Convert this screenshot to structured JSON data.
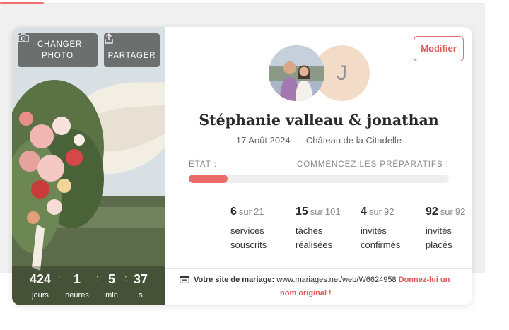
{
  "photo_panel": {
    "change_photo_label_line1": "CHANGER",
    "change_photo_label_line2": "PHOTO",
    "share_label": "PARTAGER",
    "countdown": [
      {
        "value": "424",
        "unit": "jours"
      },
      {
        "value": "1",
        "unit": "heures"
      },
      {
        "value": "5",
        "unit": "min"
      },
      {
        "value": "37",
        "unit": "s"
      }
    ],
    "separator": ":"
  },
  "info_panel": {
    "edit_label": "Modifier",
    "partner_initial": "J",
    "couple_name": "Stéphanie valleau & jonathan",
    "date": "17 Août 2024",
    "venue": "Château de la Citadelle",
    "state_label": "ÉTAT :",
    "state_text": "COMMENCEZ LES PRÉPARATIFS !",
    "progress_fraction": 0.15,
    "stats": [
      {
        "value": "6",
        "of": "sur",
        "total": "21",
        "desc_line1": "services",
        "desc_line2": "souscrits"
      },
      {
        "value": "15",
        "of": "sur",
        "total": "101",
        "desc_line1": "tâches",
        "desc_line2": "réalisées"
      },
      {
        "value": "4",
        "of": "sur",
        "total": "92",
        "desc_line1": "invités",
        "desc_line2": "confirmés"
      },
      {
        "value": "92",
        "of": "sur",
        "total": "92",
        "desc_line1": "invités",
        "desc_line2": "placés"
      }
    ],
    "site_label": "Votre site de mariage:",
    "site_url": "www.mariages.net/web/W6624958",
    "site_cta_line1": "Donnez-lui un",
    "site_cta_line2": "nom original !"
  },
  "colors": {
    "accent": "#e05a5a",
    "progress": "#ec6a6a",
    "avatar_bg": "#f2dcc8"
  }
}
